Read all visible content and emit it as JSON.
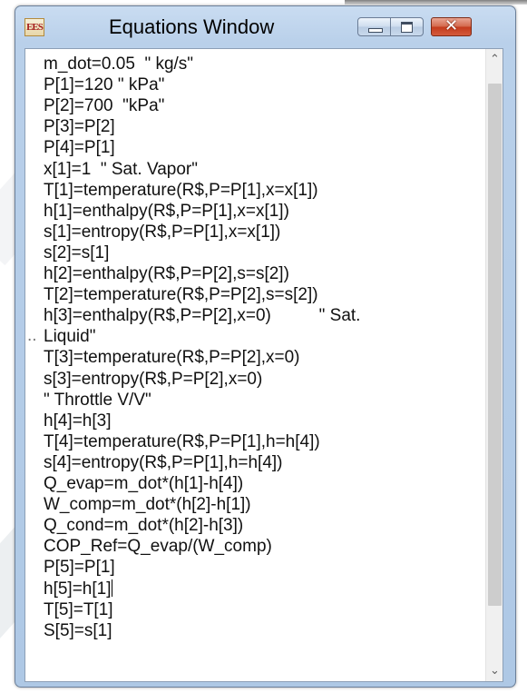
{
  "window": {
    "title": "Equations Window",
    "icon_text": "EES",
    "close_glyph": "✕"
  },
  "editor": {
    "lines": [
      "m_dot=0.05  \" kg/s\"",
      "P[1]=120 \" kPa\"",
      "P[2]=700  \"kPa\"",
      "P[3]=P[2]",
      "P[4]=P[1]",
      "x[1]=1  \" Sat. Vapor\"",
      "T[1]=temperature(R$,P=P[1],x=x[1])",
      "h[1]=enthalpy(R$,P=P[1],x=x[1])",
      "s[1]=entropy(R$,P=P[1],x=x[1])",
      "s[2]=s[1]",
      "h[2]=enthalpy(R$,P=P[2],s=s[2])",
      "T[2]=temperature(R$,P=P[2],s=s[2])",
      "h[3]=enthalpy(R$,P=P[2],x=0)          \" Sat.",
      "Liquid\"",
      "T[3]=temperature(R$,P=P[2],x=0)",
      "s[3]=entropy(R$,P=P[2],x=0)",
      "\" Throttle V/V\"",
      "h[4]=h[3]",
      "T[4]=temperature(R$,P=P[1],h=h[4])",
      "s[4]=entropy(R$,P=P[1],h=h[4])",
      "Q_evap=m_dot*(h[1]-h[4])",
      "W_comp=m_dot*(h[2]-h[1])",
      "Q_cond=m_dot*(h[2]-h[3])",
      "COP_Ref=Q_evap/(W_comp)",
      "P[5]=P[1]",
      "h[5]=h[1]",
      "T[5]=T[1]",
      "S[5]=s[1]"
    ],
    "wrap_marker": "..",
    "caret_line_index": 25
  },
  "scrollbar": {
    "up_arrow": "⌃",
    "down_arrow": "⌄"
  }
}
